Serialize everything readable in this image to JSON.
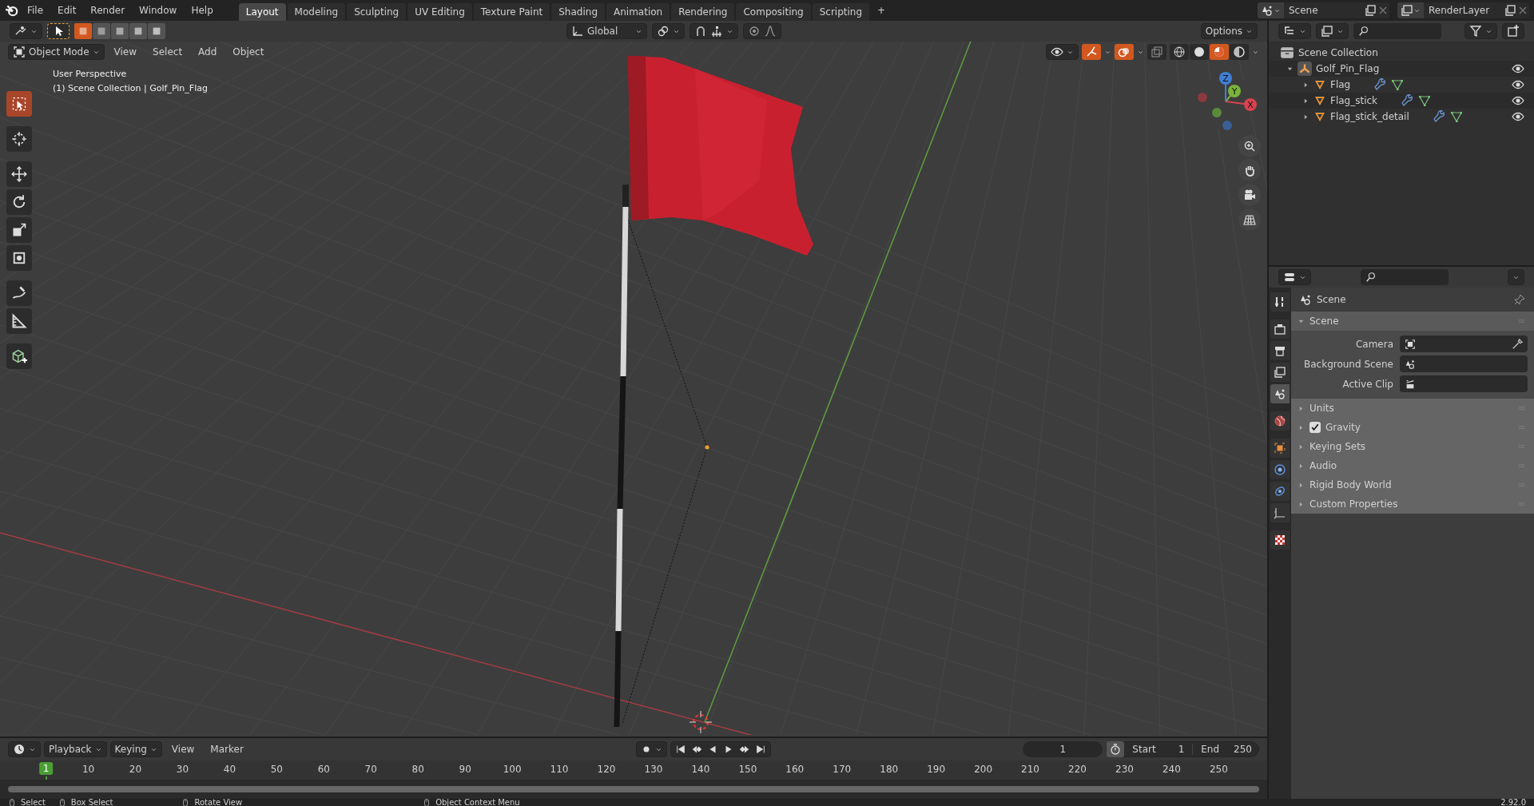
{
  "top_bar": {
    "menus": [
      "File",
      "Edit",
      "Render",
      "Window",
      "Help"
    ],
    "workspaces": [
      {
        "label": "Layout",
        "selected": true
      },
      {
        "label": "Modeling",
        "selected": false
      },
      {
        "label": "Sculpting",
        "selected": false
      },
      {
        "label": "UV Editing",
        "selected": false
      },
      {
        "label": "Texture Paint",
        "selected": false
      },
      {
        "label": "Shading",
        "selected": false
      },
      {
        "label": "Animation",
        "selected": false
      },
      {
        "label": "Rendering",
        "selected": false
      },
      {
        "label": "Compositing",
        "selected": false
      },
      {
        "label": "Scripting",
        "selected": false
      }
    ],
    "add_tab": "+",
    "scene": "Scene",
    "view_layer": "RenderLayer"
  },
  "tool_header": {
    "select_modes": [
      {
        "selected": true
      },
      {
        "selected": false
      },
      {
        "selected": false
      },
      {
        "selected": false
      },
      {
        "selected": false
      }
    ],
    "orientation": "Global",
    "options": "Options"
  },
  "viewport_header": {
    "mode": "Object Mode",
    "menus": [
      "View",
      "Select",
      "Add",
      "Object"
    ],
    "toggles": [
      {
        "kind": "gizmos",
        "on": true
      },
      {
        "kind": "overlays",
        "on": true
      },
      {
        "kind": "xray",
        "on": false
      }
    ],
    "shading": [
      {
        "kind": "wireframe",
        "selected": false
      },
      {
        "kind": "solid",
        "selected": false
      },
      {
        "kind": "material",
        "selected": true
      },
      {
        "kind": "rendered",
        "selected": false
      }
    ]
  },
  "viewport": {
    "info": [
      "User Perspective",
      "(1) Scene Collection | Golf_Pin_Flag"
    ],
    "gizmo_axes": [
      "X",
      "Y",
      "Z"
    ],
    "tools": [
      {
        "kind": "select_box",
        "selected": true
      },
      {
        "kind": "cursor",
        "selected": false
      },
      {
        "kind": "move",
        "selected": false
      },
      {
        "kind": "rotate",
        "selected": false
      },
      {
        "kind": "scale",
        "selected": false
      },
      {
        "kind": "transform",
        "selected": false
      },
      {
        "kind": "annotate",
        "selected": false
      },
      {
        "kind": "measure",
        "selected": false
      },
      {
        "kind": "add_cube",
        "selected": false
      }
    ]
  },
  "outliner": {
    "root": "Scene Collection",
    "tree": [
      {
        "name": "Golf_Pin_Flag",
        "kind": "empty",
        "expanded": true,
        "children": [
          {
            "name": "Flag",
            "kind": "mesh",
            "expanded": false
          },
          {
            "name": "Flag_stick",
            "kind": "mesh",
            "expanded": false
          },
          {
            "name": "Flag_stick_detail",
            "kind": "mesh",
            "expanded": false
          }
        ]
      }
    ]
  },
  "properties": {
    "context": "Scene",
    "tabs": [
      {
        "kind": "tool",
        "selected": false
      },
      {
        "kind": "render",
        "selected": false
      },
      {
        "kind": "output",
        "selected": false
      },
      {
        "kind": "view_layer",
        "selected": false
      },
      {
        "kind": "scene",
        "selected": true
      },
      {
        "kind": "world",
        "selected": false
      },
      {
        "kind": "object",
        "selected": false
      },
      {
        "kind": "physics",
        "selected": false
      },
      {
        "kind": "constraints",
        "selected": false
      },
      {
        "kind": "data",
        "selected": false
      },
      {
        "kind": "texture",
        "selected": false
      }
    ],
    "panels": [
      {
        "title": "Scene",
        "expanded": true,
        "fields": [
          {
            "label": "Camera",
            "kind": "camera"
          },
          {
            "label": "Background Scene",
            "kind": "scene"
          },
          {
            "label": "Active Clip",
            "kind": "clip"
          }
        ]
      },
      {
        "title": "Units",
        "expanded": false
      },
      {
        "title": "Gravity",
        "expanded": false,
        "checked": true
      },
      {
        "title": "Keying Sets",
        "expanded": false
      },
      {
        "title": "Audio",
        "expanded": false
      },
      {
        "title": "Rigid Body World",
        "expanded": false
      },
      {
        "title": "Custom Properties",
        "expanded": false
      }
    ]
  },
  "timeline": {
    "menus": [
      "Playback",
      "Keying",
      "View",
      "Marker"
    ],
    "current_frame": "1",
    "start_label": "Start",
    "start": "1",
    "end_label": "End",
    "end": "250",
    "playhead": "1",
    "ticks": [
      "10",
      "20",
      "30",
      "40",
      "50",
      "60",
      "70",
      "80",
      "90",
      "100",
      "110",
      "120",
      "130",
      "140",
      "150",
      "160",
      "170",
      "180",
      "190",
      "200",
      "210",
      "220",
      "230",
      "240",
      "250"
    ]
  },
  "status_bar": {
    "items": [
      "Select",
      "Box Select",
      "Rotate View",
      "Object Context Menu"
    ],
    "version": "2.92.0"
  }
}
